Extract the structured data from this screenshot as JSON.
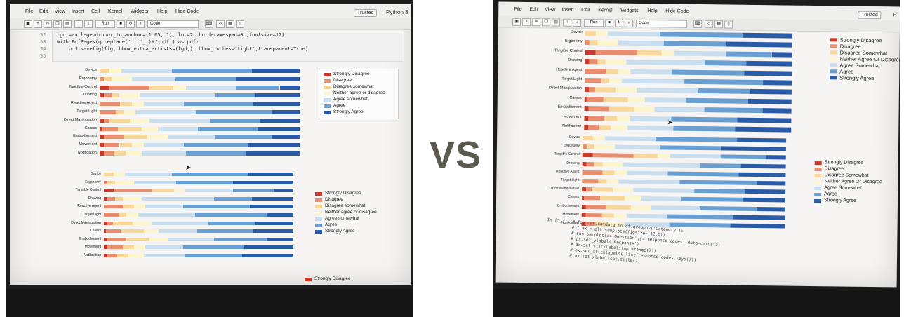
{
  "menu": [
    "File",
    "Edit",
    "View",
    "Insert",
    "Cell",
    "Kernel",
    "Widgets",
    "Help",
    "Hide Code"
  ],
  "trusted_label": "Trusted",
  "kernel_label": "Python 3",
  "kernel_label_right": "P",
  "cell_type": "Code",
  "run_label": "Run",
  "code_left": [
    {
      "n": "52",
      "text": "lgd =ax.legend(bbox_to_anchor=(1.05, 1), loc=2, borderaxespad=0.,fontsize=12)"
    },
    {
      "n": "53",
      "text": "with PdfPages(q.replace(' ','_')+'.pdf') as pdf:"
    },
    {
      "n": "54",
      "text": "    pdf.savefig(fig, bbox_extra_artists=(lgd,), bbox_inches='tight',transparent=True)"
    },
    {
      "n": "55",
      "text": ""
    }
  ],
  "code_right_prompt": "In [5]:",
  "code_right": [
    "# for cat,catdata in df.groupby('Category'):",
    "#     f,ax = plt.subplots(figsize=(12,6))",
    "#     sns.barplot(x='Question',y='response_codes',data=catdata)",
    "#     ax.set_ylabel('Response')",
    "#     ax.set_yticklabels(np.arange(7))",
    "#     ax.set_xticklabels( list(response_codes.keys()))",
    "#     ax.set_xlabel(cat.title())"
  ],
  "categories": [
    "Device",
    "Ergonomy",
    "Tangible Control",
    "Drawing",
    "Reactive Agent",
    "Target Light",
    "Direct Manipulation",
    "Caress",
    "Embodiement",
    "Movement",
    "Notification"
  ],
  "legend_left": [
    "Strongly Disagree",
    "Disagree",
    "Disagree somewhat",
    "Neither agree or disagree",
    "Agree somewhat",
    "Agree",
    "Strongly Agree"
  ],
  "legend_right": [
    "Strongly Disagree",
    "Disagree",
    "Disagree Somewhat",
    "Neither Agree Or Disagree",
    "Agree Somewhat",
    "Agree",
    "Strongly Agree"
  ],
  "legend_bottom_left": "Strongly Disagree",
  "vs_label": "VS",
  "colors": [
    "#c83a2c",
    "#ea8c6e",
    "#f7d79a",
    "#fdf5cc",
    "#c9dff0",
    "#6a9fd3",
    "#2a5ba6"
  ],
  "chart_data": [
    {
      "type": "bar",
      "stacked": true,
      "orientation": "horizontal",
      "categories": [
        "Device",
        "Ergonomy",
        "Tangible Control",
        "Drawing",
        "Reactive Agent",
        "Target Light",
        "Direct Manipulation",
        "Caress",
        "Embodiement",
        "Movement",
        "Notification"
      ],
      "series": [
        {
          "name": "Strongly Disagree",
          "values": [
            0,
            0,
            5,
            2,
            0,
            0,
            2,
            1,
            2,
            2,
            2
          ]
        },
        {
          "name": "Disagree",
          "values": [
            0,
            2,
            20,
            4,
            10,
            8,
            3,
            8,
            10,
            8,
            5
          ]
        },
        {
          "name": "Disagree somewhat",
          "values": [
            5,
            4,
            12,
            4,
            6,
            4,
            10,
            12,
            12,
            6,
            6
          ]
        },
        {
          "name": "Neither agree or disagree",
          "values": [
            6,
            10,
            6,
            10,
            6,
            6,
            10,
            8,
            10,
            6,
            8
          ]
        },
        {
          "name": "Agree somewhat",
          "values": [
            25,
            22,
            25,
            38,
            20,
            30,
            30,
            20,
            24,
            20,
            22
          ]
        },
        {
          "name": "Agree",
          "values": [
            40,
            30,
            22,
            20,
            35,
            38,
            25,
            30,
            28,
            32,
            30
          ]
        },
        {
          "name": "Strongly Agree",
          "values": [
            24,
            32,
            10,
            22,
            23,
            14,
            20,
            21,
            14,
            26,
            27
          ]
        }
      ]
    }
  ]
}
